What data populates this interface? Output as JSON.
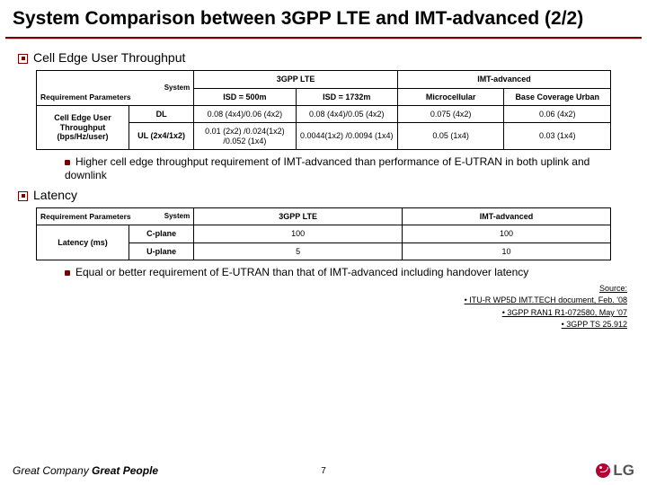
{
  "title": "System Comparison between 3GPP LTE and IMT-advanced (2/2)",
  "section1": {
    "heading": "Cell Edge User Throughput",
    "system_label": "System",
    "req_label": "Requirement Parameters",
    "col_lte": "3GPP LTE",
    "col_imt": "IMT-advanced",
    "lte_isd500": "ISD = 500m",
    "lte_isd1732": "ISD = 1732m",
    "imt_micro": "Microcellular",
    "imt_base": "Base Coverage Urban",
    "row1_hdr": "Cell Edge User Throughput (bps/Hz/user)",
    "row1_sub_dl": "DL",
    "row1_sub_ul": "UL (2x4/1x2)",
    "dl_isd500": "0.08 (4x4)/0.06 (4x2)",
    "dl_isd1732": "0.08 (4x4)/0.05 (4x2)",
    "dl_micro": "0.075 (4x2)",
    "dl_base": "0.06 (4x2)",
    "ul_isd500": "0.01 (2x2) /0.024(1x2) /0.052 (1x4)",
    "ul_isd1732": "0.0044(1x2) /0.0094 (1x4)",
    "ul_micro": "0.05 (1x4)",
    "ul_base": "0.03 (1x4)",
    "bullet1": "Higher cell edge throughput requirement of IMT-advanced than performance of E-UTRAN in both uplink and downlink"
  },
  "section2": {
    "heading": "Latency",
    "system_label": "System",
    "req_label": "Requirement Parameters",
    "col_lte": "3GPP LTE",
    "col_imt": "IMT-advanced",
    "row_hdr": "Latency (ms)",
    "row_cplane": "C-plane",
    "row_uplane": "U-plane",
    "cplane_lte": "100",
    "cplane_imt": "100",
    "uplane_lte": "5",
    "uplane_imt": "10",
    "bullet1": "Equal or better requirement of E-UTRAN than that of IMT-advanced including handover latency"
  },
  "sources": {
    "label": "Source:",
    "s1": "• ITU-R WP5D IMT.TECH document, Feb. '08",
    "s2": "• 3GPP RAN1 R1-072580, May '07",
    "s3": "• 3GPP TS 25.912"
  },
  "footer": {
    "tagline_plain": "Great Company ",
    "tagline_bold": "Great People",
    "page": "7",
    "logo_text": "LG"
  }
}
